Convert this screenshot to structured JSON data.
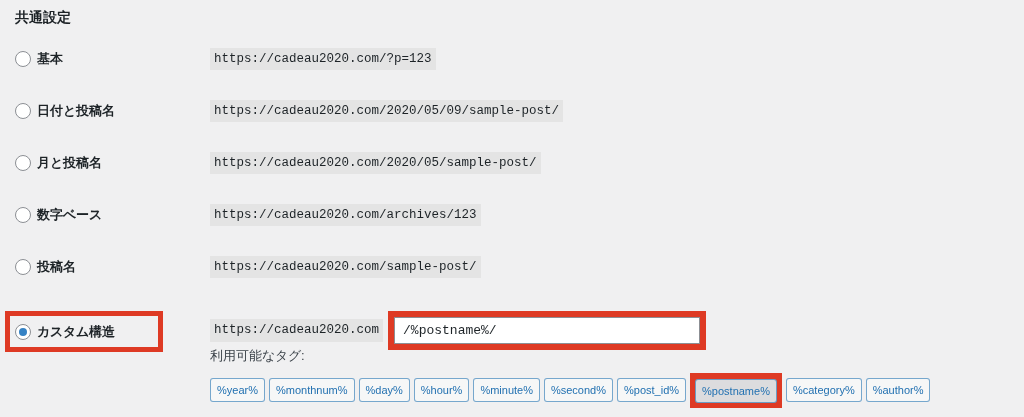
{
  "heading": "共通設定",
  "options": [
    {
      "label": "基本",
      "example": "https://cadeau2020.com/?p=123",
      "selected": false,
      "highlighted": false
    },
    {
      "label": "日付と投稿名",
      "example": "https://cadeau2020.com/2020/05/09/sample-post/",
      "selected": false,
      "highlighted": false
    },
    {
      "label": "月と投稿名",
      "example": "https://cadeau2020.com/2020/05/sample-post/",
      "selected": false,
      "highlighted": false
    },
    {
      "label": "数字ベース",
      "example": "https://cadeau2020.com/archives/123",
      "selected": false,
      "highlighted": false
    },
    {
      "label": "投稿名",
      "example": "https://cadeau2020.com/sample-post/",
      "selected": false,
      "highlighted": false
    },
    {
      "label": "カスタム構造",
      "example": "https://cadeau2020.com",
      "selected": true,
      "highlighted": true,
      "kind": "custom"
    }
  ],
  "custom_field": {
    "value": "/%postname%/",
    "highlighted": true
  },
  "tags_label": "利用可能なタグ:",
  "tags": [
    {
      "label": "%year%",
      "selected": false,
      "highlighted": false
    },
    {
      "label": "%monthnum%",
      "selected": false,
      "highlighted": false
    },
    {
      "label": "%day%",
      "selected": false,
      "highlighted": false
    },
    {
      "label": "%hour%",
      "selected": false,
      "highlighted": false
    },
    {
      "label": "%minute%",
      "selected": false,
      "highlighted": false
    },
    {
      "label": "%second%",
      "selected": false,
      "highlighted": false
    },
    {
      "label": "%post_id%",
      "selected": false,
      "highlighted": false
    },
    {
      "label": "%postname%",
      "selected": true,
      "highlighted": true
    },
    {
      "label": "%category%",
      "selected": false,
      "highlighted": false
    },
    {
      "label": "%author%",
      "selected": false,
      "highlighted": false
    }
  ]
}
